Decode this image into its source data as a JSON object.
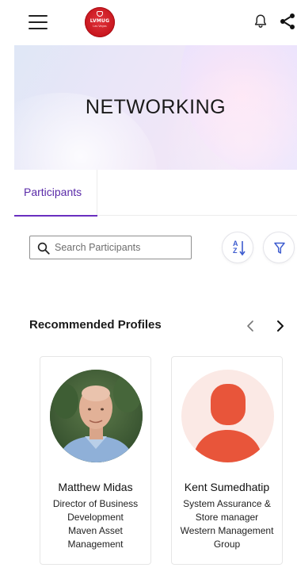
{
  "header": {
    "menu_icon": "hamburger-menu-icon",
    "logo_text": "LVMUG",
    "logo_subtext": "Las Vegas",
    "notification_icon": "bell-icon",
    "share_icon": "share-icon"
  },
  "hero": {
    "title": "NETWORKING"
  },
  "tabs": [
    {
      "label": "Participants",
      "active": true
    }
  ],
  "search": {
    "placeholder": "Search Participants",
    "value": "",
    "icon": "search-icon"
  },
  "toolbar": {
    "sort_icon": "sort-az-icon",
    "sort_a": "A",
    "sort_z": "Z",
    "filter_icon": "filter-icon"
  },
  "recommended": {
    "title": "Recommended Profiles",
    "prev_icon": "chevron-left-icon",
    "next_icon": "chevron-right-icon",
    "profiles": [
      {
        "name": "Matthew Midas",
        "role": "Director of Business Development",
        "organization": "Maven Asset Management",
        "avatar": "photo"
      },
      {
        "name": "Kent Sumedhatip",
        "role": "System Assurance & Store manager",
        "organization": "Western Management Group",
        "avatar": "placeholder-person-icon"
      }
    ]
  },
  "colors": {
    "accent": "#6a2fc0",
    "icon_blue": "#3d5ccf",
    "placeholder_avatar": "#e8553a",
    "logo_red": "#c8161e"
  }
}
